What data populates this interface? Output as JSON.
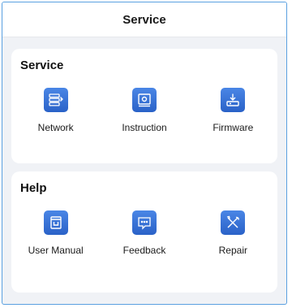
{
  "header": {
    "title": "Service"
  },
  "sections": [
    {
      "title": "Service",
      "items": [
        {
          "label": "Network",
          "icon": "network-icon"
        },
        {
          "label": "Instruction",
          "icon": "instruction-icon"
        },
        {
          "label": "Firmware",
          "icon": "firmware-download-icon"
        }
      ]
    },
    {
      "title": "Help",
      "items": [
        {
          "label": "User Manual",
          "icon": "manual-book-icon"
        },
        {
          "label": "Feedback",
          "icon": "feedback-chat-icon"
        },
        {
          "label": "Repair",
          "icon": "repair-tools-icon"
        }
      ]
    }
  ],
  "colors": {
    "accent": "#3a76d8",
    "frame_border": "#5aa0e0",
    "background": "#f0f2f6"
  }
}
